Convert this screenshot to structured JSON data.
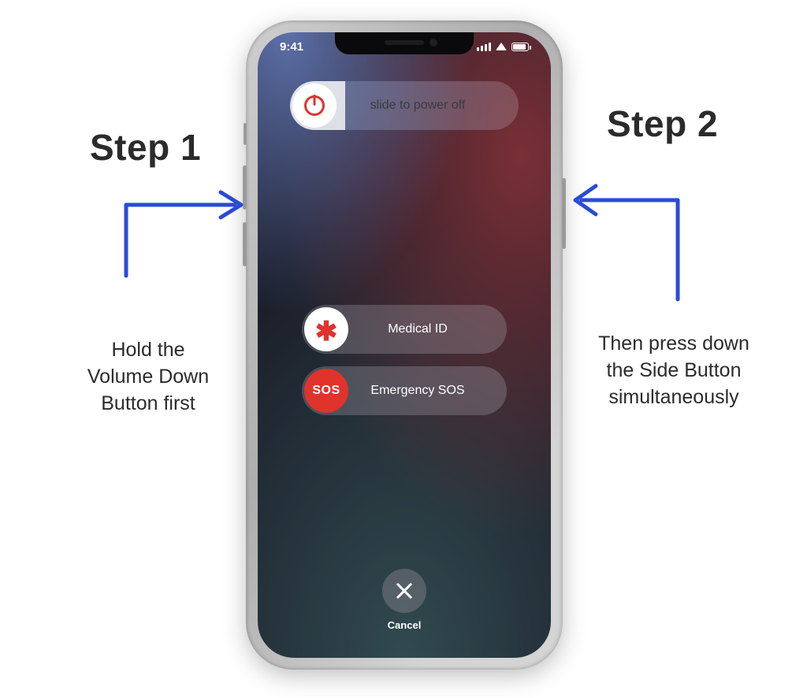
{
  "status_time": "9:41",
  "sliders": {
    "power_label": "slide to power off",
    "medical_label": "Medical ID",
    "sos_knob": "SOS",
    "sos_label": "Emergency SOS"
  },
  "cancel_label": "Cancel",
  "annotations": {
    "step1_title": "Step 1",
    "step1_body": "Hold the\nVolume Down\nButton first",
    "step2_title": "Step 2",
    "step2_body": "Then press down\nthe Side Button\nsimultaneously"
  }
}
